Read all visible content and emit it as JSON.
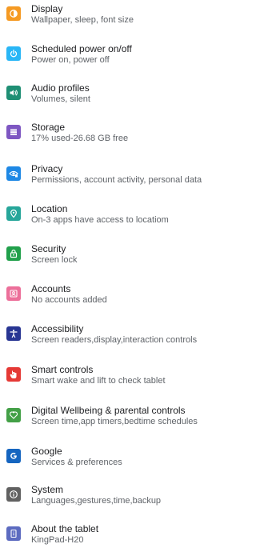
{
  "settings": {
    "items": [
      {
        "title": "Display",
        "subtitle": "Wallpaper, sleep, font size",
        "icon": "display-icon",
        "color": "#F59A23"
      },
      {
        "title": "Scheduled power on/off",
        "subtitle": "Power on, power off",
        "icon": "power-icon",
        "color": "#29B6F6"
      },
      {
        "title": "Audio profiles",
        "subtitle": "Volumes, silent",
        "icon": "volume-icon",
        "color": "#1F8F74"
      },
      {
        "title": "Storage",
        "subtitle": "17% used-26.68 GB free",
        "icon": "storage-icon",
        "color": "#7E57C2"
      },
      {
        "title": "Privacy",
        "subtitle": "Permissions, account activity, personal data",
        "icon": "privacy-eye-icon",
        "color": "#1E88E5"
      },
      {
        "title": "Location",
        "subtitle": "On-3 apps have access to locatiom",
        "icon": "location-pin-icon",
        "color": "#26A69A"
      },
      {
        "title": "Security",
        "subtitle": "Screen lock",
        "icon": "lock-icon",
        "color": "#21A04B"
      },
      {
        "title": "Accounts",
        "subtitle": "No accounts added",
        "icon": "account-icon",
        "color": "#EC6F9A"
      },
      {
        "title": "Accessibility",
        "subtitle": "Screen readers,display,interaction controls",
        "icon": "accessibility-icon",
        "color": "#283593"
      },
      {
        "title": "Smart controls",
        "subtitle": "Smart wake and lift to check tablet",
        "icon": "hand-icon",
        "color": "#E53935"
      },
      {
        "title": "Digital Wellbeing & parental controls",
        "subtitle": "Screen time,app timers,bedtime schedules",
        "icon": "wellbeing-heart-icon",
        "color": "#43A047"
      },
      {
        "title": "Google",
        "subtitle": "Services & preferences",
        "icon": "google-icon",
        "color": "#1565C0"
      },
      {
        "title": "System",
        "subtitle": "Languages,gestures,time,backup",
        "icon": "info-icon",
        "color": "#616161"
      },
      {
        "title": "About the tablet",
        "subtitle": "KingPad-H20",
        "icon": "tablet-icon",
        "color": "#5C6BC0"
      }
    ]
  }
}
